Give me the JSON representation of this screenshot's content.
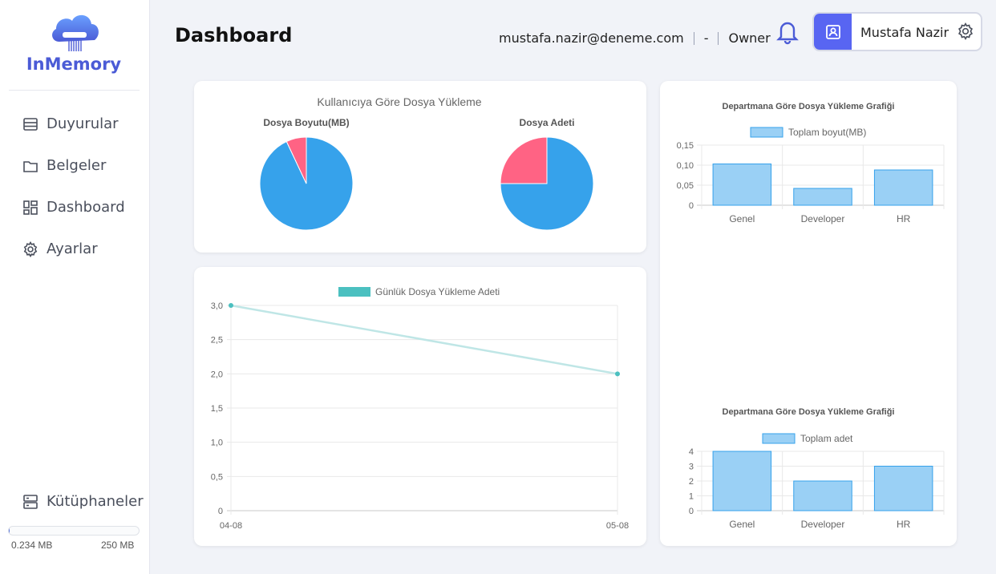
{
  "app": {
    "name": "InMemory"
  },
  "sidebar": {
    "items": [
      {
        "label": "Duyurular",
        "icon": "list-icon"
      },
      {
        "label": "Belgeler",
        "icon": "folder-icon"
      },
      {
        "label": "Dashboard",
        "icon": "dashboard-icon"
      },
      {
        "label": "Ayarlar",
        "icon": "gear-icon"
      }
    ],
    "libraries": {
      "label": "Kütüphaneler",
      "icon": "server-icon"
    },
    "storage": {
      "used": "0.234 MB",
      "total": "250 MB",
      "used_fraction": 0.001
    }
  },
  "header": {
    "title": "Dashboard",
    "email": "mustafa.nazir@deneme.com",
    "dash": "-",
    "role": "Owner",
    "user_name": "Mustafa Nazir"
  },
  "colors": {
    "accent": "#5865f2",
    "blue": "#36a2eb",
    "pink": "#ff6384",
    "teal": "#4bc0c0",
    "bar_fill": "#9ad0f5"
  },
  "chart_data": [
    {
      "type": "pie",
      "title": "Kullanıcıya Göre Dosya Yükleme",
      "subtitle": "Dosya Boyutu(MB)",
      "values": [
        0.93,
        0.07
      ],
      "colors": [
        "#36a2eb",
        "#ff6384"
      ]
    },
    {
      "type": "pie",
      "title": "Kullanıcıya Göre Dosya Yükleme",
      "subtitle": "Dosya Adeti",
      "values": [
        3,
        1
      ],
      "colors": [
        "#36a2eb",
        "#ff6384"
      ]
    },
    {
      "type": "line",
      "series": [
        {
          "name": "Günlük Dosya Yükleme Adeti",
          "values": [
            3,
            2
          ]
        }
      ],
      "x": [
        "04-08",
        "05-08"
      ],
      "yticks": [
        "0",
        "0,5",
        "1,0",
        "1,5",
        "2,0",
        "2,5",
        "3,0"
      ],
      "ylim": [
        0,
        3
      ],
      "grid": true,
      "legend": "top"
    },
    {
      "type": "bar",
      "title": "Departmana Göre Dosya Yükleme Grafiği",
      "categories": [
        "Genel",
        "Developer",
        "HR"
      ],
      "series": [
        {
          "name": "Toplam boyut(MB)",
          "values": [
            0.103,
            0.042,
            0.088
          ]
        }
      ],
      "yticks": [
        "0",
        "0,05",
        "0,10",
        "0,15"
      ],
      "ylim": [
        0,
        0.15
      ],
      "legend": "top"
    },
    {
      "type": "bar",
      "title": "Departmana Göre Dosya Yükleme Grafiği",
      "categories": [
        "Genel",
        "Developer",
        "HR"
      ],
      "series": [
        {
          "name": "Toplam adet",
          "values": [
            4,
            2,
            3
          ]
        }
      ],
      "yticks": [
        "0",
        "1",
        "2",
        "3",
        "4"
      ],
      "ylim": [
        0,
        4
      ],
      "legend": "top"
    }
  ]
}
